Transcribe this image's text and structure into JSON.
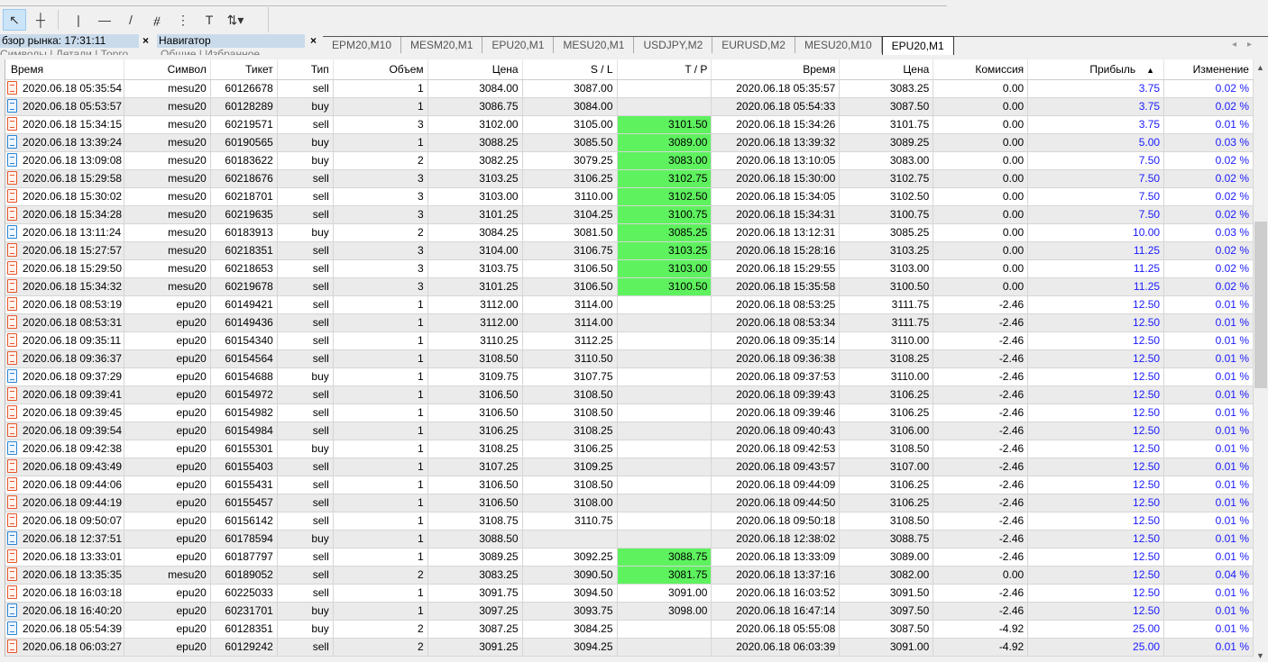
{
  "market_watch": {
    "title": "бзор рынка: 17:31:11",
    "tabs": [
      "Символы",
      "Детали",
      "Торго"
    ]
  },
  "navigator": {
    "title": "Навигатор",
    "tabs": [
      "Общие",
      "Избранное"
    ]
  },
  "close_glyph": "×",
  "chart_tabs": [
    "EPM20,M10",
    "MESM20,M1",
    "EPU20,M1",
    "MESU20,M1",
    "USDJPY,M2",
    "EURUSD,M2",
    "MESU20,M10",
    "EPU20,M1"
  ],
  "active_chart_tab": 7,
  "columns": [
    "Время",
    "Символ",
    "Тикет",
    "Тип",
    "Объем",
    "Цена",
    "S / L",
    "T / P",
    "Время",
    "Цена",
    "Комиссия",
    "Прибыль",
    "Изменение"
  ],
  "sort_indicator": "▲",
  "colors": {
    "tp_highlight": "#5ef25e",
    "profit": "#1a1aff",
    "sell_icon": "#e8562a",
    "buy_icon": "#2a86d4"
  },
  "rows": [
    [
      "2020.06.18 05:35:54",
      "mesu20",
      "60126678",
      "sell",
      "1",
      "3084.00",
      "3087.00",
      "",
      "2020.06.18 05:35:57",
      "3083.25",
      "0.00",
      "3.75",
      "0.02 %"
    ],
    [
      "2020.06.18 05:53:57",
      "mesu20",
      "60128289",
      "buy",
      "1",
      "3086.75",
      "3084.00",
      "",
      "2020.06.18 05:54:33",
      "3087.50",
      "0.00",
      "3.75",
      "0.02 %"
    ],
    [
      "2020.06.18 15:34:15",
      "mesu20",
      "60219571",
      "sell",
      "3",
      "3102.00",
      "3105.00",
      "3101.50",
      "2020.06.18 15:34:26",
      "3101.75",
      "0.00",
      "3.75",
      "0.01 %"
    ],
    [
      "2020.06.18 13:39:24",
      "mesu20",
      "60190565",
      "buy",
      "1",
      "3088.25",
      "3085.50",
      "3089.00",
      "2020.06.18 13:39:32",
      "3089.25",
      "0.00",
      "5.00",
      "0.03 %"
    ],
    [
      "2020.06.18 13:09:08",
      "mesu20",
      "60183622",
      "buy",
      "2",
      "3082.25",
      "3079.25",
      "3083.00",
      "2020.06.18 13:10:05",
      "3083.00",
      "0.00",
      "7.50",
      "0.02 %"
    ],
    [
      "2020.06.18 15:29:58",
      "mesu20",
      "60218676",
      "sell",
      "3",
      "3103.25",
      "3106.25",
      "3102.75",
      "2020.06.18 15:30:00",
      "3102.75",
      "0.00",
      "7.50",
      "0.02 %"
    ],
    [
      "2020.06.18 15:30:02",
      "mesu20",
      "60218701",
      "sell",
      "3",
      "3103.00",
      "3110.00",
      "3102.50",
      "2020.06.18 15:34:05",
      "3102.50",
      "0.00",
      "7.50",
      "0.02 %"
    ],
    [
      "2020.06.18 15:34:28",
      "mesu20",
      "60219635",
      "sell",
      "3",
      "3101.25",
      "3104.25",
      "3100.75",
      "2020.06.18 15:34:31",
      "3100.75",
      "0.00",
      "7.50",
      "0.02 %"
    ],
    [
      "2020.06.18 13:11:24",
      "mesu20",
      "60183913",
      "buy",
      "2",
      "3084.25",
      "3081.50",
      "3085.25",
      "2020.06.18 13:12:31",
      "3085.25",
      "0.00",
      "10.00",
      "0.03 %"
    ],
    [
      "2020.06.18 15:27:57",
      "mesu20",
      "60218351",
      "sell",
      "3",
      "3104.00",
      "3106.75",
      "3103.25",
      "2020.06.18 15:28:16",
      "3103.25",
      "0.00",
      "11.25",
      "0.02 %"
    ],
    [
      "2020.06.18 15:29:50",
      "mesu20",
      "60218653",
      "sell",
      "3",
      "3103.75",
      "3106.50",
      "3103.00",
      "2020.06.18 15:29:55",
      "3103.00",
      "0.00",
      "11.25",
      "0.02 %"
    ],
    [
      "2020.06.18 15:34:32",
      "mesu20",
      "60219678",
      "sell",
      "3",
      "3101.25",
      "3106.50",
      "3100.50",
      "2020.06.18 15:35:58",
      "3100.50",
      "0.00",
      "11.25",
      "0.02 %"
    ],
    [
      "2020.06.18 08:53:19",
      "epu20",
      "60149421",
      "sell",
      "1",
      "3112.00",
      "3114.00",
      "",
      "2020.06.18 08:53:25",
      "3111.75",
      "-2.46",
      "12.50",
      "0.01 %"
    ],
    [
      "2020.06.18 08:53:31",
      "epu20",
      "60149436",
      "sell",
      "1",
      "3112.00",
      "3114.00",
      "",
      "2020.06.18 08:53:34",
      "3111.75",
      "-2.46",
      "12.50",
      "0.01 %"
    ],
    [
      "2020.06.18 09:35:11",
      "epu20",
      "60154340",
      "sell",
      "1",
      "3110.25",
      "3112.25",
      "",
      "2020.06.18 09:35:14",
      "3110.00",
      "-2.46",
      "12.50",
      "0.01 %"
    ],
    [
      "2020.06.18 09:36:37",
      "epu20",
      "60154564",
      "sell",
      "1",
      "3108.50",
      "3110.50",
      "",
      "2020.06.18 09:36:38",
      "3108.25",
      "-2.46",
      "12.50",
      "0.01 %"
    ],
    [
      "2020.06.18 09:37:29",
      "epu20",
      "60154688",
      "buy",
      "1",
      "3109.75",
      "3107.75",
      "",
      "2020.06.18 09:37:53",
      "3110.00",
      "-2.46",
      "12.50",
      "0.01 %"
    ],
    [
      "2020.06.18 09:39:41",
      "epu20",
      "60154972",
      "sell",
      "1",
      "3106.50",
      "3108.50",
      "",
      "2020.06.18 09:39:43",
      "3106.25",
      "-2.46",
      "12.50",
      "0.01 %"
    ],
    [
      "2020.06.18 09:39:45",
      "epu20",
      "60154982",
      "sell",
      "1",
      "3106.50",
      "3108.50",
      "",
      "2020.06.18 09:39:46",
      "3106.25",
      "-2.46",
      "12.50",
      "0.01 %"
    ],
    [
      "2020.06.18 09:39:54",
      "epu20",
      "60154984",
      "sell",
      "1",
      "3106.25",
      "3108.25",
      "",
      "2020.06.18 09:40:43",
      "3106.00",
      "-2.46",
      "12.50",
      "0.01 %"
    ],
    [
      "2020.06.18 09:42:38",
      "epu20",
      "60155301",
      "buy",
      "1",
      "3108.25",
      "3106.25",
      "",
      "2020.06.18 09:42:53",
      "3108.50",
      "-2.46",
      "12.50",
      "0.01 %"
    ],
    [
      "2020.06.18 09:43:49",
      "epu20",
      "60155403",
      "sell",
      "1",
      "3107.25",
      "3109.25",
      "",
      "2020.06.18 09:43:57",
      "3107.00",
      "-2.46",
      "12.50",
      "0.01 %"
    ],
    [
      "2020.06.18 09:44:06",
      "epu20",
      "60155431",
      "sell",
      "1",
      "3106.50",
      "3108.50",
      "",
      "2020.06.18 09:44:09",
      "3106.25",
      "-2.46",
      "12.50",
      "0.01 %"
    ],
    [
      "2020.06.18 09:44:19",
      "epu20",
      "60155457",
      "sell",
      "1",
      "3106.50",
      "3108.00",
      "",
      "2020.06.18 09:44:50",
      "3106.25",
      "-2.46",
      "12.50",
      "0.01 %"
    ],
    [
      "2020.06.18 09:50:07",
      "epu20",
      "60156142",
      "sell",
      "1",
      "3108.75",
      "3110.75",
      "",
      "2020.06.18 09:50:18",
      "3108.50",
      "-2.46",
      "12.50",
      "0.01 %"
    ],
    [
      "2020.06.18 12:37:51",
      "epu20",
      "60178594",
      "buy",
      "1",
      "3088.50",
      "",
      "",
      "2020.06.18 12:38:02",
      "3088.75",
      "-2.46",
      "12.50",
      "0.01 %"
    ],
    [
      "2020.06.18 13:33:01",
      "epu20",
      "60187797",
      "sell",
      "1",
      "3089.25",
      "3092.25",
      "3088.75",
      "2020.06.18 13:33:09",
      "3089.00",
      "-2.46",
      "12.50",
      "0.01 %"
    ],
    [
      "2020.06.18 13:35:35",
      "mesu20",
      "60189052",
      "sell",
      "2",
      "3083.25",
      "3090.50",
      "3081.75",
      "2020.06.18 13:37:16",
      "3082.00",
      "0.00",
      "12.50",
      "0.04 %"
    ],
    [
      "2020.06.18 16:03:18",
      "epu20",
      "60225033",
      "sell",
      "1",
      "3091.75",
      "3094.50",
      "3091.00",
      "2020.06.18 16:03:52",
      "3091.50",
      "-2.46",
      "12.50",
      "0.01 %"
    ],
    [
      "2020.06.18 16:40:20",
      "epu20",
      "60231701",
      "buy",
      "1",
      "3097.25",
      "3093.75",
      "3098.00",
      "2020.06.18 16:47:14",
      "3097.50",
      "-2.46",
      "12.50",
      "0.01 %"
    ],
    [
      "2020.06.18 05:54:39",
      "epu20",
      "60128351",
      "buy",
      "2",
      "3087.25",
      "3084.25",
      "",
      "2020.06.18 05:55:08",
      "3087.50",
      "-4.92",
      "25.00",
      "0.01 %"
    ],
    [
      "2020.06.18 06:03:27",
      "epu20",
      "60129242",
      "sell",
      "2",
      "3091.25",
      "3094.25",
      "",
      "2020.06.18 06:03:39",
      "3091.00",
      "-4.92",
      "25.00",
      "0.01 %"
    ]
  ],
  "tp_highlighted_rows": [
    2,
    3,
    4,
    5,
    6,
    7,
    8,
    9,
    10,
    11,
    26,
    27
  ]
}
